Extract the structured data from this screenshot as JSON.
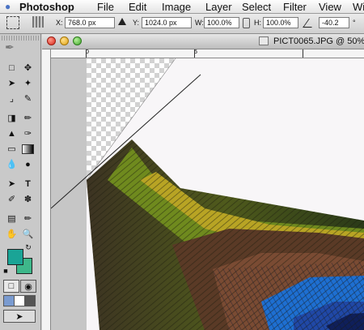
{
  "menubar": {
    "apple_icon": "apple-icon",
    "app_name": "Photoshop",
    "items": [
      "File",
      "Edit",
      "Image",
      "Layer",
      "Select",
      "Filter",
      "View",
      "Wi"
    ]
  },
  "options": {
    "x_label": "X:",
    "x_value": "768.0 px",
    "y_label": "Y:",
    "y_value": "1024.0 px",
    "w_label": "W:",
    "w_value": "100.0%",
    "h_label": "H:",
    "h_value": "100.0%",
    "angle_value": "-40.2",
    "degree": "°"
  },
  "document": {
    "title": "PICT0065.JPG @ 50%",
    "ruler_h": [
      "0",
      "5"
    ]
  },
  "colors": {
    "foreground": "#1aa496",
    "background": "#3eb78a"
  }
}
